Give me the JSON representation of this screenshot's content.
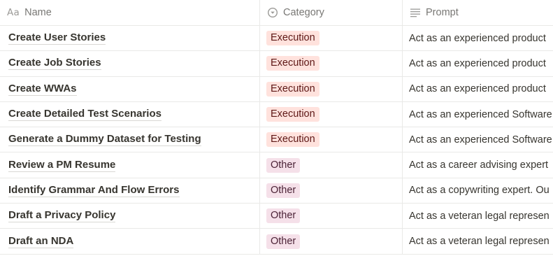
{
  "headers": {
    "name": {
      "label": "Name",
      "icon": "Aa"
    },
    "category": {
      "label": "Category"
    },
    "prompt": {
      "label": "Prompt"
    }
  },
  "colors": {
    "execution_bg": "#ffe2dd",
    "execution_fg": "#5d1715",
    "other_bg": "#f5e0e9",
    "other_fg": "#4c2337"
  },
  "rows": [
    {
      "name": "Create User Stories",
      "category": "Execution",
      "prompt": "Act as an experienced product"
    },
    {
      "name": "Create Job Stories",
      "category": "Execution",
      "prompt": "Act as an experienced product"
    },
    {
      "name": "Create WWAs",
      "category": "Execution",
      "prompt": "Act as an experienced product"
    },
    {
      "name": "Create Detailed Test Scenarios",
      "category": "Execution",
      "prompt": "Act as an experienced Software"
    },
    {
      "name": "Generate a Dummy Dataset for Testing",
      "category": "Execution",
      "prompt": "Act as an experienced Software"
    },
    {
      "name": "Review a PM Resume",
      "category": "Other",
      "prompt": "Act as a career advising expert"
    },
    {
      "name": "Identify Grammar And Flow Errors",
      "category": "Other",
      "prompt": "Act as a copywriting expert. Ou"
    },
    {
      "name": "Draft a Privacy Policy",
      "category": "Other",
      "prompt": "Act as a veteran legal represen"
    },
    {
      "name": "Draft an NDA",
      "category": "Other",
      "prompt": "Act as a veteran legal represen"
    }
  ]
}
